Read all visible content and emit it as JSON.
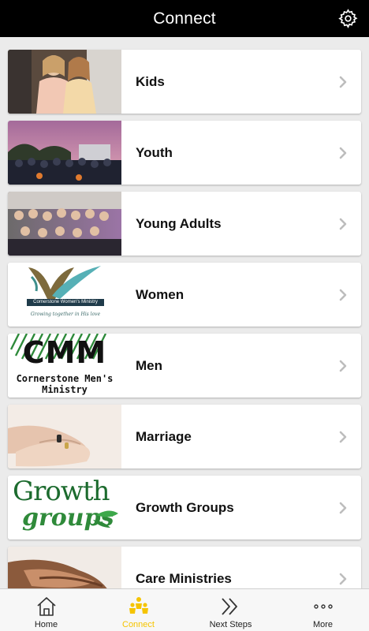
{
  "header": {
    "title": "Connect",
    "settings_icon": "gear-icon"
  },
  "items": [
    {
      "label": "Kids",
      "thumb": "kids-photo"
    },
    {
      "label": "Youth",
      "thumb": "youth-photo"
    },
    {
      "label": "Young Adults",
      "thumb": "young-adults-photo"
    },
    {
      "label": "Women",
      "thumb": "women-logo",
      "logo_title": "Cornerstone Women's Ministry",
      "logo_tagline": "Growing together in His love"
    },
    {
      "label": "Men",
      "thumb": "men-logo",
      "logo_big": "CMM",
      "logo_line1": "Cornerstone Men's",
      "logo_line2": "Ministry"
    },
    {
      "label": "Marriage",
      "thumb": "marriage-photo"
    },
    {
      "label": "Growth Groups",
      "thumb": "growth-groups-logo",
      "logo_line1": "Growth",
      "logo_line2": "groups"
    },
    {
      "label": "Care Ministries",
      "thumb": "care-photo"
    }
  ],
  "tabs": [
    {
      "label": "Home",
      "icon": "home-icon",
      "active": false
    },
    {
      "label": "Connect",
      "icon": "people-icon",
      "active": true
    },
    {
      "label": "Next Steps",
      "icon": "double-chevron-icon",
      "active": false
    },
    {
      "label": "More",
      "icon": "more-icon",
      "active": false
    }
  ],
  "colors": {
    "header_bg": "#000000",
    "accent": "#f5c400",
    "tabbar_bg": "#f7f7f7",
    "background": "#ebebeb"
  }
}
